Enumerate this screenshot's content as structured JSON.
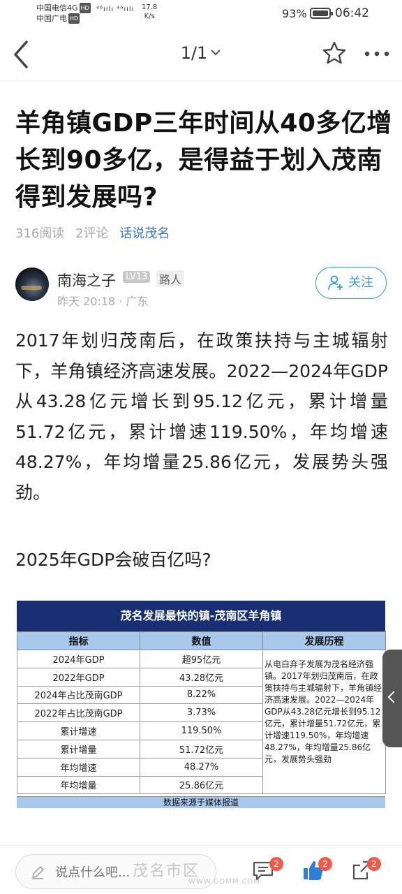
{
  "status_bar": {
    "carrier1": "中国电信4G",
    "carrier2": "中国广电",
    "hd": "HD",
    "signal": "⁴⁶ıılı ⁴⁶ıılı",
    "speed_value": "17.8",
    "speed_unit": "K/s",
    "battery": "93%",
    "time": "06:42"
  },
  "nav": {
    "page_indicator": "1/1"
  },
  "article": {
    "title": "羊角镇GDP三年时间从40多亿增长到90多亿，是得益于划入茂南得到发展吗?",
    "reads": "316阅读",
    "comments": "2评论",
    "topic": "话说茂名"
  },
  "author": {
    "name": "南海之子",
    "level": "LV13",
    "role": "路人",
    "time_location": "昨天 20:18 · 广东",
    "follow_label": "关注"
  },
  "body": {
    "paragraph1": "2017年划归茂南后，在政策扶持与主城辐射下，羊角镇经济高速发展。2022—2024年GDP从43.28亿元增长到95.12亿元，累计增量51.72亿元，累计增速119.50%，年均增速48.27%，年均增量25.86亿元，发展势头强劲。",
    "paragraph2": "2025年GDP会破百亿吗?"
  },
  "info_table": {
    "title": "茂名发展最快的镇-茂南区羊角镇",
    "headers": [
      "指标",
      "数值",
      "发展历程"
    ],
    "rows": [
      [
        "2024年GDP",
        "超95亿元"
      ],
      [
        "2022年GDP",
        "43.28亿元"
      ],
      [
        "2024年占比茂南GDP",
        "8.22%"
      ],
      [
        "2022年占比茂南GDP",
        "3.73%"
      ],
      [
        "累计增速",
        "119.50%"
      ],
      [
        "累计增量",
        "51.72亿元"
      ],
      [
        "年均增速",
        "48.27%"
      ],
      [
        "年均增量",
        "25.86亿元"
      ]
    ],
    "history": "从电白弃子发展为茂名经济强镇。2017年划归茂南后，在政策扶持与主城辐射下，羊角镇经济高速发展。2022—2024年GDP从43.28亿元增长到95.12亿元，累计增量51.72亿元，累计增速119.50%，年均增速48.27%，年均增量25.86亿元，发展势头强劲",
    "source": "数据来源于媒体报道"
  },
  "bottom_bar": {
    "comment_placeholder": "说点什么吧...",
    "comment_badge": "2",
    "like_badge": "2",
    "share_badge": "2",
    "watermark": "茂名市区",
    "watermark_url": "WWW.GDMM.COM"
  },
  "colors": {
    "accent": "#35a0d6",
    "topic": "#3b76c8",
    "badge": "#f05a4a",
    "table_header": "#1a2f72",
    "table_subheader": "#a8c8ec"
  }
}
